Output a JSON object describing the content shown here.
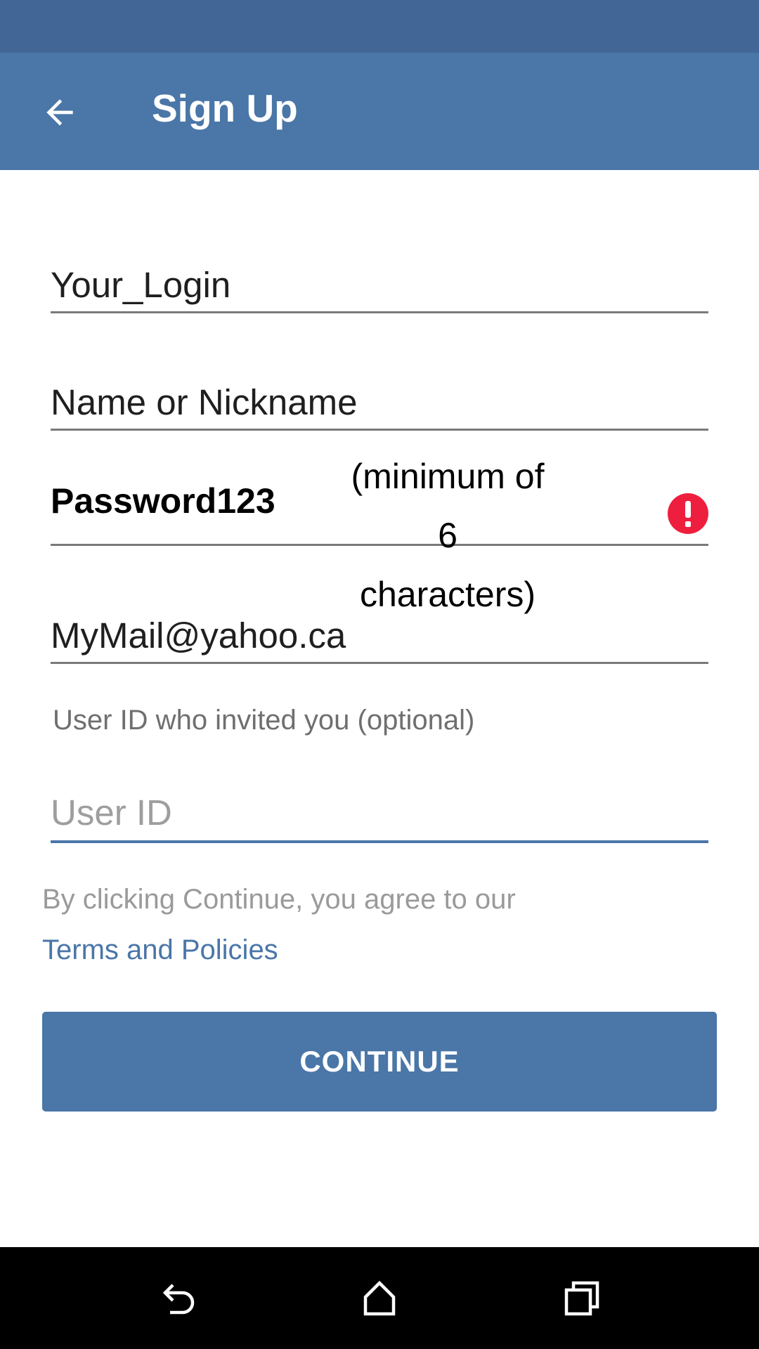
{
  "app_bar": {
    "title": "Sign Up",
    "back_icon": "arrow-left-icon"
  },
  "form": {
    "login": {
      "value": "Your_Login"
    },
    "name": {
      "value": "Name or Nickname"
    },
    "password": {
      "value": "Password123",
      "hint_line1": "(minimum of",
      "hint_line2": "6 characters)",
      "error_icon": "error-exclamation-icon"
    },
    "email": {
      "value": "MyMail@yahoo.ca"
    },
    "invite_label": "User ID who invited you (optional)",
    "user_id": {
      "placeholder": "User ID",
      "value": ""
    }
  },
  "terms": {
    "text": "By clicking Continue, you agree to our",
    "link": "Terms and Policies"
  },
  "continue_label": "CONTINUE",
  "nav": {
    "back_icon": "back-nav-icon",
    "home_icon": "home-icon",
    "recents_icon": "recents-icon"
  },
  "colors": {
    "status_bar": "#426796",
    "primary": "#4a76a8",
    "error": "#ee1f3e"
  }
}
